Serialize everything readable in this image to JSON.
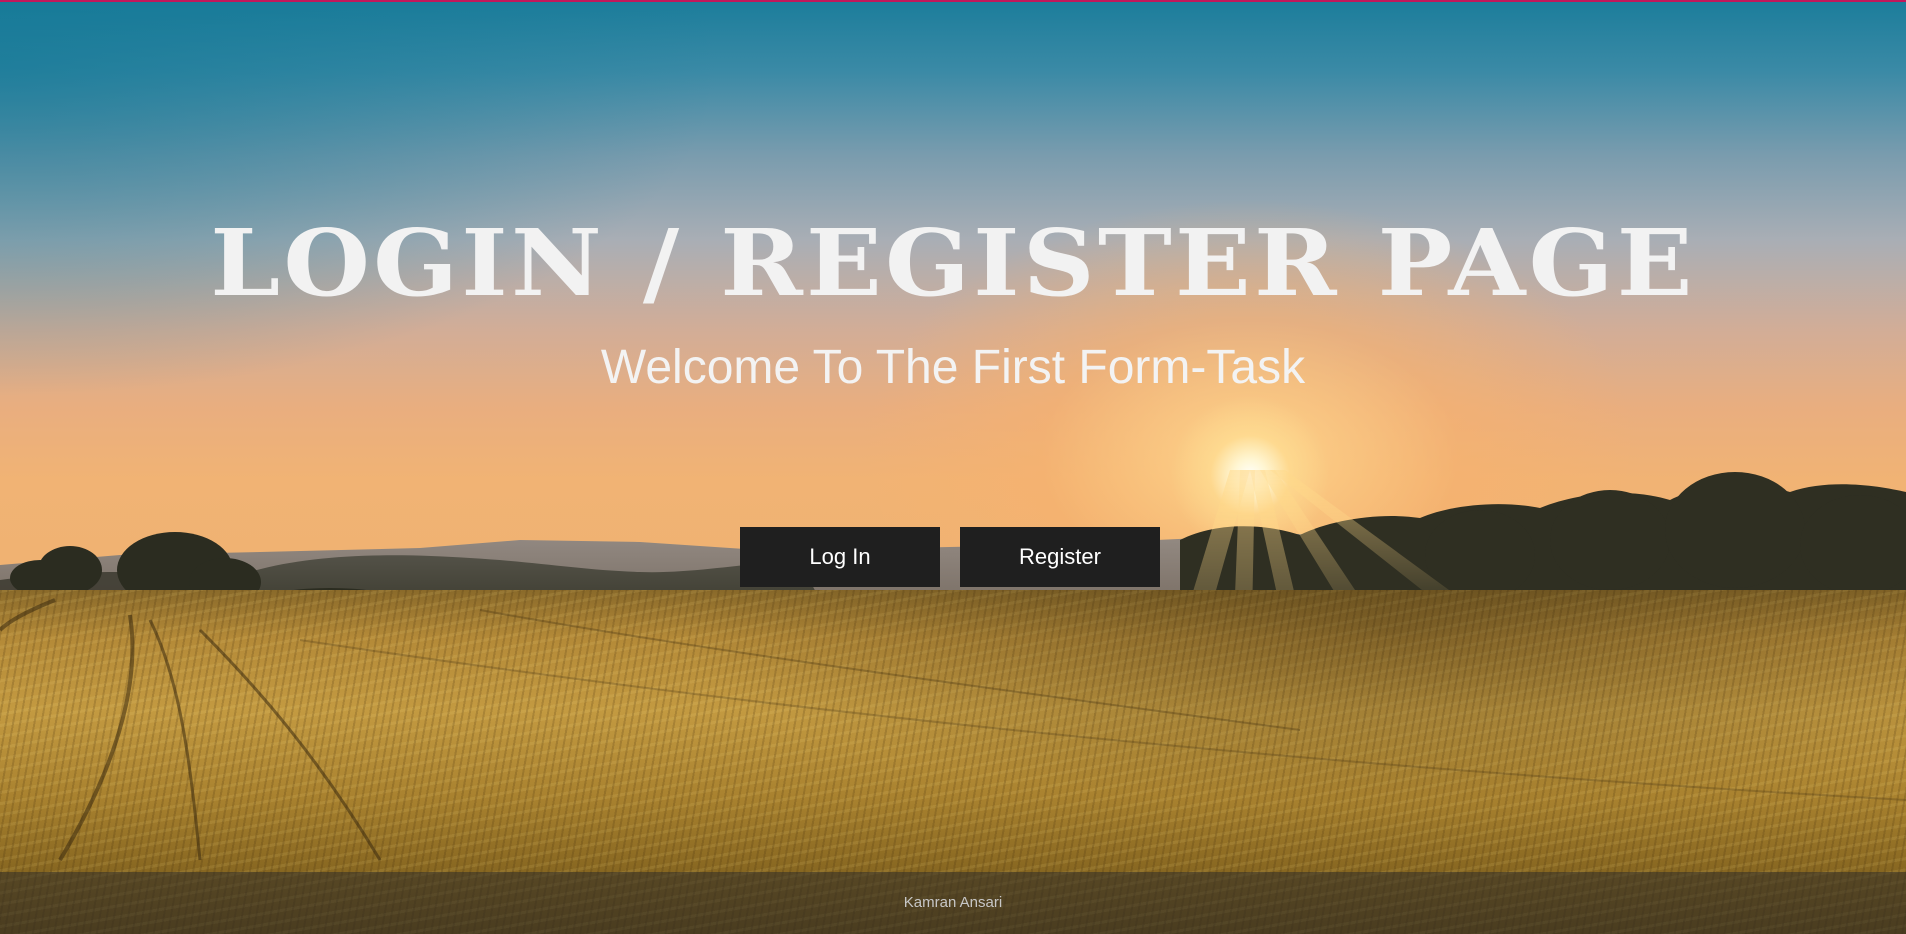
{
  "colors": {
    "top_accent": "#c2185b",
    "button_bg": "#1f1f1f",
    "button_text": "#ffffff",
    "title_text": "#f2f2f2",
    "footer_text": "#c7c7c7"
  },
  "hero": {
    "title": "Login / Register Page",
    "subtitle": "Welcome To The First Form-Task"
  },
  "buttons": {
    "login_label": "Log In",
    "register_label": "Register"
  },
  "footer": {
    "author": "Kamran Ansari"
  },
  "background": {
    "scene_icon": "sunset-wheat-field-image"
  }
}
